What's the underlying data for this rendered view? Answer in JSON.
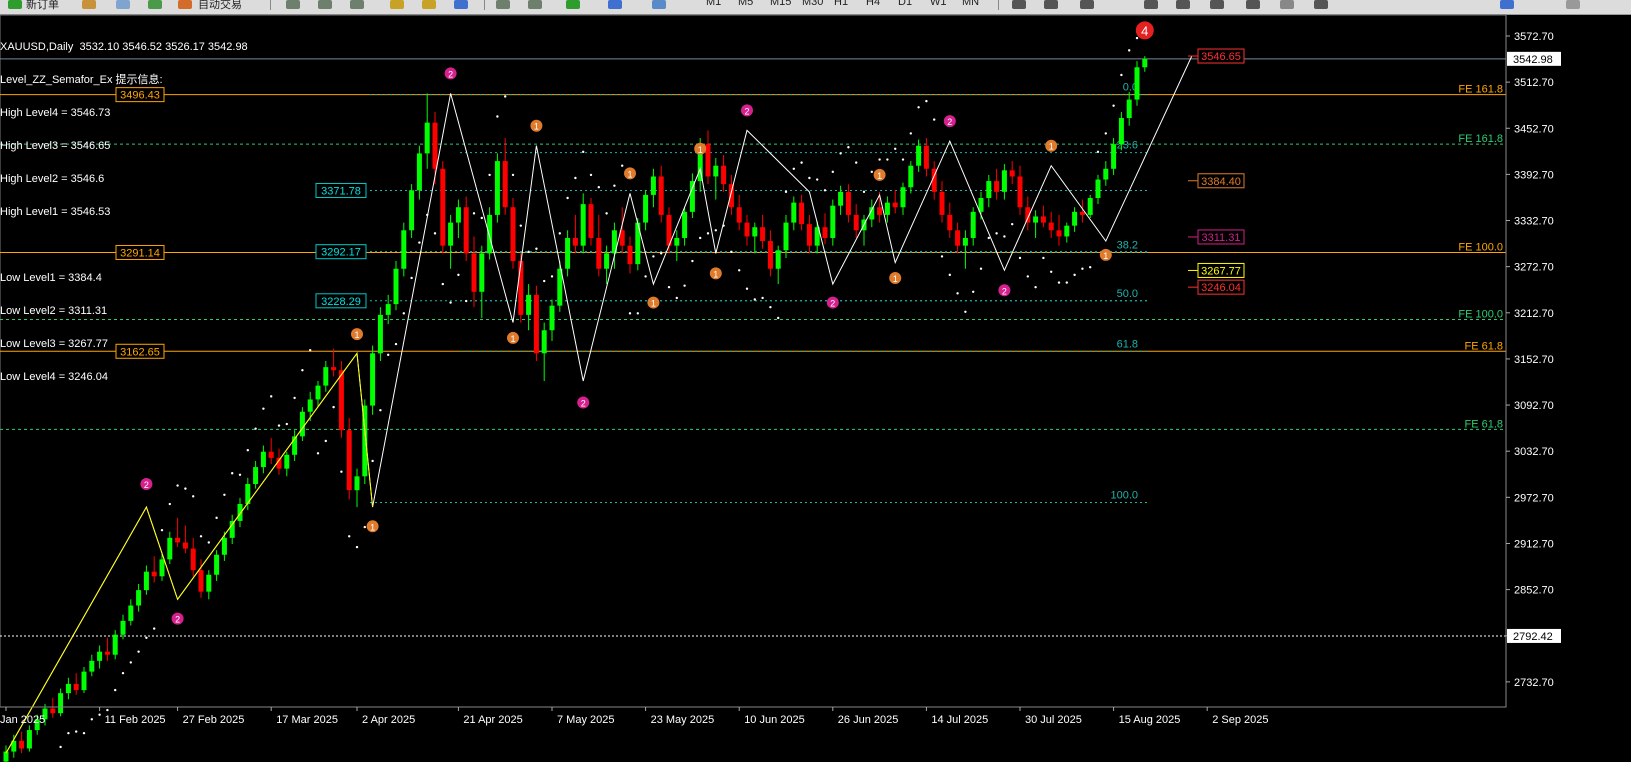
{
  "toolbar": {
    "new_order": "新订单",
    "auto_trading": "自动交易",
    "timeframes": [
      "M1",
      "M5",
      "M15",
      "M30",
      "H1",
      "H4",
      "D1",
      "W1",
      "MN"
    ]
  },
  "header": {
    "symbol_line": "XAUUSD,Daily  3532.10 3546.52 3526.17 3542.98",
    "indicator_line": "Level_ZZ_Semafor_Ex 提示信息:"
  },
  "levels_text": [
    "High Level4 = 3546.73",
    "High Level3 = 3546.65",
    "High Level2 = 3546.6",
    "High Level1 = 3546.53",
    "",
    "Low Level1 = 3384.4",
    "Low Level2 = 3311.31",
    "Low Level3 = 3267.77",
    "Low Level4 = 3246.04"
  ],
  "colors": {
    "bull": "#00ff00",
    "bear": "#ff0000",
    "orange_line": "#ffa500",
    "teal_line": "#20b2aa",
    "green_line": "#2ecc71",
    "marker_1": "#e07b2c",
    "marker_2": "#d6208e",
    "zigzag_white": "#ffffff",
    "zigzag_yellow": "#ffff00"
  },
  "chart_data": {
    "type": "candlestick",
    "symbol": "XAUUSD",
    "timeframe": "Daily",
    "ylim": [
      2700,
      3600
    ],
    "price_axis_ticks": [
      "3572.70",
      "3512.70",
      "3452.70",
      "3392.70",
      "3332.70",
      "3272.70",
      "3212.70",
      "3152.70",
      "3092.70",
      "3032.70",
      "2972.70",
      "2912.70",
      "2852.70",
      "2792.70",
      "2732.70"
    ],
    "current_price_label": "3542.98",
    "hline_price_label": "2792.42",
    "date_labels": [
      {
        "label": "Jan 2025",
        "i": 0
      },
      {
        "label": "11 Feb 2025",
        "i": 12
      },
      {
        "label": "27 Feb 2025",
        "i": 22
      },
      {
        "label": "17 Mar 2025",
        "i": 34
      },
      {
        "label": "2 Apr 2025",
        "i": 45
      },
      {
        "label": "21 Apr 2025",
        "i": 58
      },
      {
        "label": "7 May 2025",
        "i": 70
      },
      {
        "label": "23 May 2025",
        "i": 82
      },
      {
        "label": "10 Jun 2025",
        "i": 94
      },
      {
        "label": "26 Jun 2025",
        "i": 106
      },
      {
        "label": "14 Jul 2025",
        "i": 118
      },
      {
        "label": "30 Jul 2025",
        "i": 130
      },
      {
        "label": "15 Aug 2025",
        "i": 142
      },
      {
        "label": "2 Sep 2025",
        "i": 154
      }
    ],
    "fe_levels": [
      {
        "price": 3496.43,
        "label": "FE 161.8",
        "color": "#ffa500",
        "left_label": "3496.43"
      },
      {
        "price": 3432.0,
        "label": "FE 161.8",
        "color": "#2ecc71"
      },
      {
        "price": 3291.14,
        "label": "FE 100.0",
        "color": "#ffa500",
        "left_label": "3291.14"
      },
      {
        "price": 3204.0,
        "label": "FE 100.0",
        "color": "#2ecc71"
      },
      {
        "price": 3162.65,
        "label": "FE 61.8",
        "color": "#ffa500",
        "left_label": "3162.65"
      },
      {
        "price": 3061.0,
        "label": "FE 61.8",
        "color": "#2ecc71"
      }
    ],
    "fibo_levels": [
      {
        "price": 3496.43,
        "label": "0.0"
      },
      {
        "price": 3421.0,
        "label": "23.6"
      },
      {
        "price": 3291.14,
        "label": "38.2"
      },
      {
        "price": 3228.29,
        "label": "50.0"
      },
      {
        "price": 3162.65,
        "label": "61.8"
      },
      {
        "price": 2966.0,
        "label": "100.0"
      }
    ],
    "teal_boxes": [
      {
        "price": 3371.78,
        "label": "3371.78"
      },
      {
        "price": 3292.17,
        "label": "3292.17"
      },
      {
        "price": 3228.29,
        "label": "3228.29"
      }
    ],
    "right_level_labels": [
      {
        "price": 3546.65,
        "label": "3546.65",
        "color": "#ff3030"
      },
      {
        "price": 3384.4,
        "label": "3384.40",
        "color": "#e07b2c"
      },
      {
        "price": 3311.31,
        "label": "3311.31",
        "color": "#d6208e"
      },
      {
        "price": 3267.77,
        "label": "3267.77",
        "color": "#ffff00"
      },
      {
        "price": 3246.04,
        "label": "3246.04",
        "color": "#ff3030"
      }
    ],
    "top_marker": "4",
    "candles": [
      [
        2629,
        2650,
        2625,
        2642
      ],
      [
        2642,
        2664,
        2634,
        2656
      ],
      [
        2656,
        2668,
        2640,
        2646
      ],
      [
        2646,
        2676,
        2642,
        2670
      ],
      [
        2670,
        2690,
        2664,
        2684
      ],
      [
        2684,
        2704,
        2676,
        2698
      ],
      [
        2698,
        2712,
        2686,
        2692
      ],
      [
        2692,
        2724,
        2688,
        2718
      ],
      [
        2718,
        2738,
        2710,
        2730
      ],
      [
        2730,
        2744,
        2716,
        2722
      ],
      [
        2722,
        2752,
        2718,
        2746
      ],
      [
        2746,
        2768,
        2740,
        2760
      ],
      [
        2760,
        2780,
        2750,
        2772
      ],
      [
        2772,
        2790,
        2760,
        2768
      ],
      [
        2768,
        2800,
        2762,
        2794
      ],
      [
        2794,
        2820,
        2788,
        2812
      ],
      [
        2812,
        2840,
        2806,
        2832
      ],
      [
        2832,
        2860,
        2824,
        2852
      ],
      [
        2852,
        2884,
        2846,
        2876
      ],
      [
        2876,
        2896,
        2862,
        2870
      ],
      [
        2870,
        2900,
        2864,
        2892
      ],
      [
        2892,
        2928,
        2886,
        2920
      ],
      [
        2920,
        2946,
        2908,
        2914
      ],
      [
        2914,
        2936,
        2900,
        2906
      ],
      [
        2906,
        2920,
        2870,
        2878
      ],
      [
        2878,
        2892,
        2842,
        2850
      ],
      [
        2850,
        2878,
        2840,
        2872
      ],
      [
        2872,
        2904,
        2864,
        2898
      ],
      [
        2898,
        2928,
        2890,
        2920
      ],
      [
        2920,
        2950,
        2912,
        2942
      ],
      [
        2942,
        2972,
        2934,
        2964
      ],
      [
        2964,
        2998,
        2956,
        2990
      ],
      [
        2990,
        3020,
        2984,
        3012
      ],
      [
        3012,
        3040,
        3004,
        3032
      ],
      [
        3032,
        3050,
        3016,
        3024
      ],
      [
        3024,
        3036,
        3002,
        3010
      ],
      [
        3010,
        3032,
        3000,
        3028
      ],
      [
        3028,
        3060,
        3020,
        3052
      ],
      [
        3052,
        3090,
        3046,
        3084
      ],
      [
        3084,
        3110,
        3072,
        3100
      ],
      [
        3100,
        3124,
        3090,
        3118
      ],
      [
        3118,
        3150,
        3110,
        3142
      ],
      [
        3142,
        3166,
        3130,
        3138
      ],
      [
        3138,
        3150,
        3050,
        3060
      ],
      [
        3060,
        3076,
        2970,
        2982
      ],
      [
        2982,
        3010,
        2960,
        3000
      ],
      [
        3000,
        3100,
        2990,
        3092
      ],
      [
        3092,
        3170,
        3080,
        3160
      ],
      [
        3160,
        3220,
        3150,
        3210
      ],
      [
        3210,
        3236,
        3198,
        3224
      ],
      [
        3224,
        3280,
        3216,
        3270
      ],
      [
        3270,
        3330,
        3260,
        3320
      ],
      [
        3320,
        3380,
        3310,
        3372
      ],
      [
        3372,
        3430,
        3360,
        3420
      ],
      [
        3420,
        3498,
        3400,
        3460
      ],
      [
        3460,
        3474,
        3380,
        3400
      ],
      [
        3400,
        3410,
        3290,
        3300
      ],
      [
        3300,
        3340,
        3270,
        3330
      ],
      [
        3330,
        3360,
        3310,
        3350
      ],
      [
        3350,
        3364,
        3280,
        3290
      ],
      [
        3290,
        3312,
        3220,
        3240
      ],
      [
        3240,
        3300,
        3206,
        3290
      ],
      [
        3290,
        3350,
        3282,
        3340
      ],
      [
        3340,
        3420,
        3330,
        3410
      ],
      [
        3410,
        3440,
        3340,
        3350
      ],
      [
        3350,
        3362,
        3270,
        3280
      ],
      [
        3280,
        3290,
        3200,
        3210
      ],
      [
        3210,
        3250,
        3190,
        3236
      ],
      [
        3236,
        3248,
        3150,
        3160
      ],
      [
        3160,
        3200,
        3124,
        3190
      ],
      [
        3190,
        3230,
        3176,
        3222
      ],
      [
        3222,
        3280,
        3214,
        3270
      ],
      [
        3270,
        3320,
        3260,
        3310
      ],
      [
        3310,
        3340,
        3290,
        3300
      ],
      [
        3300,
        3368,
        3290,
        3354
      ],
      [
        3354,
        3362,
        3300,
        3310
      ],
      [
        3310,
        3340,
        3260,
        3270
      ],
      [
        3270,
        3300,
        3250,
        3290
      ],
      [
        3290,
        3330,
        3270,
        3320
      ],
      [
        3320,
        3350,
        3290,
        3300
      ],
      [
        3300,
        3312,
        3264,
        3276
      ],
      [
        3276,
        3336,
        3268,
        3330
      ],
      [
        3330,
        3372,
        3320,
        3366
      ],
      [
        3366,
        3400,
        3350,
        3390
      ],
      [
        3390,
        3404,
        3330,
        3340
      ],
      [
        3340,
        3350,
        3290,
        3300
      ],
      [
        3300,
        3320,
        3280,
        3310
      ],
      [
        3310,
        3350,
        3300,
        3344
      ],
      [
        3344,
        3394,
        3336,
        3384
      ],
      [
        3384,
        3440,
        3370,
        3432
      ],
      [
        3432,
        3450,
        3380,
        3390
      ],
      [
        3390,
        3414,
        3360,
        3404
      ],
      [
        3404,
        3418,
        3370,
        3380
      ],
      [
        3380,
        3392,
        3340,
        3350
      ],
      [
        3350,
        3366,
        3320,
        3330
      ],
      [
        3330,
        3340,
        3300,
        3312
      ],
      [
        3312,
        3330,
        3290,
        3324
      ],
      [
        3324,
        3340,
        3296,
        3306
      ],
      [
        3306,
        3320,
        3260,
        3270
      ],
      [
        3270,
        3300,
        3250,
        3294
      ],
      [
        3294,
        3340,
        3284,
        3330
      ],
      [
        3330,
        3364,
        3320,
        3356
      ],
      [
        3356,
        3366,
        3320,
        3328
      ],
      [
        3328,
        3340,
        3290,
        3300
      ],
      [
        3300,
        3332,
        3290,
        3324
      ],
      [
        3324,
        3342,
        3302,
        3310
      ],
      [
        3310,
        3360,
        3300,
        3352
      ],
      [
        3352,
        3378,
        3340,
        3370
      ],
      [
        3370,
        3380,
        3330,
        3340
      ],
      [
        3340,
        3354,
        3310,
        3320
      ],
      [
        3320,
        3340,
        3300,
        3334
      ],
      [
        3334,
        3360,
        3324,
        3350
      ],
      [
        3350,
        3370,
        3330,
        3340
      ],
      [
        3340,
        3364,
        3330,
        3356
      ],
      [
        3356,
        3372,
        3342,
        3350
      ],
      [
        3350,
        3382,
        3340,
        3376
      ],
      [
        3376,
        3410,
        3368,
        3404
      ],
      [
        3404,
        3438,
        3396,
        3430
      ],
      [
        3430,
        3440,
        3390,
        3400
      ],
      [
        3400,
        3410,
        3360,
        3370
      ],
      [
        3370,
        3384,
        3330,
        3340
      ],
      [
        3340,
        3356,
        3310,
        3320
      ],
      [
        3320,
        3330,
        3290,
        3300
      ],
      [
        3300,
        3320,
        3270,
        3310
      ],
      [
        3310,
        3350,
        3300,
        3344
      ],
      [
        3344,
        3370,
        3334,
        3362
      ],
      [
        3362,
        3392,
        3350,
        3384
      ],
      [
        3384,
        3400,
        3360,
        3370
      ],
      [
        3370,
        3406,
        3360,
        3398
      ],
      [
        3398,
        3410,
        3380,
        3390
      ],
      [
        3390,
        3404,
        3340,
        3350
      ],
      [
        3350,
        3364,
        3320,
        3330
      ],
      [
        3330,
        3346,
        3310,
        3338
      ],
      [
        3338,
        3352,
        3324,
        3330
      ],
      [
        3330,
        3344,
        3310,
        3320
      ],
      [
        3320,
        3340,
        3300,
        3312
      ],
      [
        3312,
        3330,
        3304,
        3326
      ],
      [
        3326,
        3350,
        3318,
        3344
      ],
      [
        3344,
        3360,
        3330,
        3340
      ],
      [
        3340,
        3366,
        3336,
        3362
      ],
      [
        3362,
        3392,
        3354,
        3386
      ],
      [
        3386,
        3410,
        3378,
        3400
      ],
      [
        3400,
        3440,
        3392,
        3432
      ],
      [
        3432,
        3474,
        3424,
        3466
      ],
      [
        3466,
        3500,
        3456,
        3490
      ],
      [
        3490,
        3540,
        3482,
        3532
      ],
      [
        3532,
        3546.52,
        3526.17,
        3542.98
      ]
    ]
  }
}
